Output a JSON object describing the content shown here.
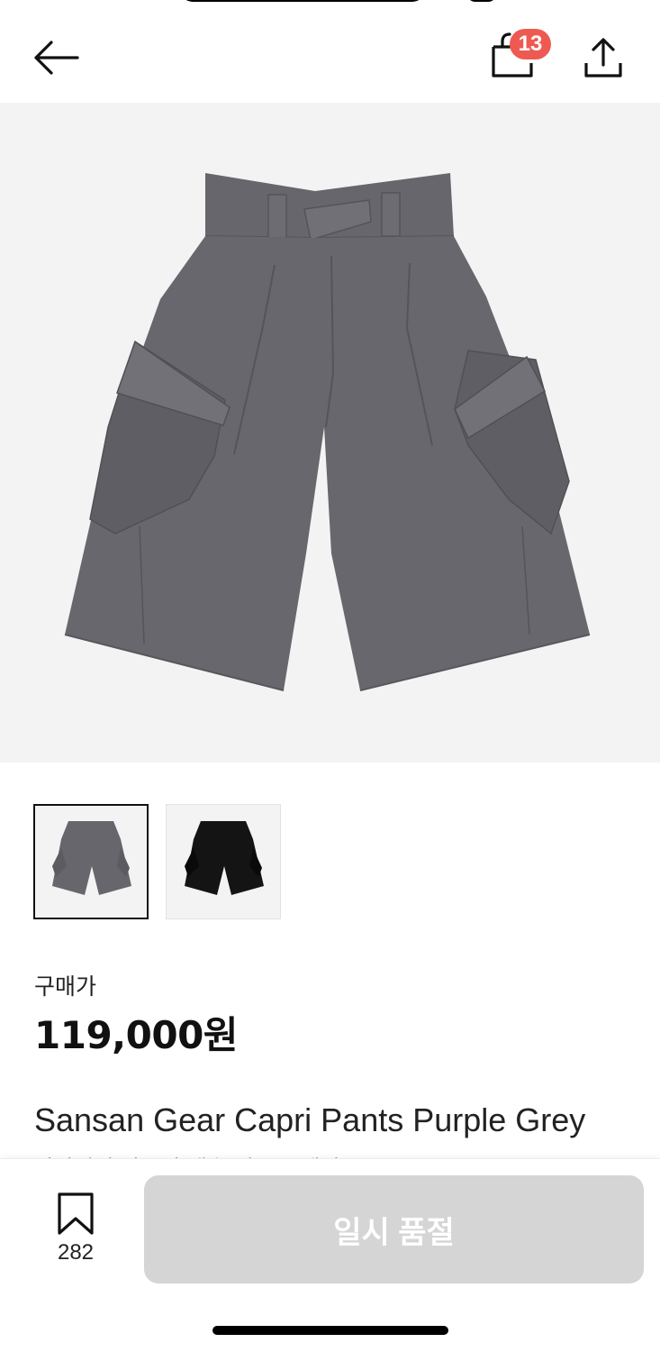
{
  "header": {
    "cart_count": "13"
  },
  "product": {
    "price_label": "구매가",
    "price": "119,000원",
    "title_en": "Sansan Gear Capri Pants Purple Grey",
    "title_ko": "산산기어 카프리 팬츠 퍼플 그레이",
    "thumbnails": [
      {
        "name": "grey",
        "color": "#67666c"
      },
      {
        "name": "black",
        "color": "#141414"
      }
    ],
    "main_color": "#6a6970"
  },
  "bottom_bar": {
    "wish_count": "282",
    "action_label": "일시 품절"
  },
  "colors": {
    "badge": "#ee5a52",
    "disabled_button": "#d5d5d5",
    "image_background": "#f3f3f3"
  }
}
